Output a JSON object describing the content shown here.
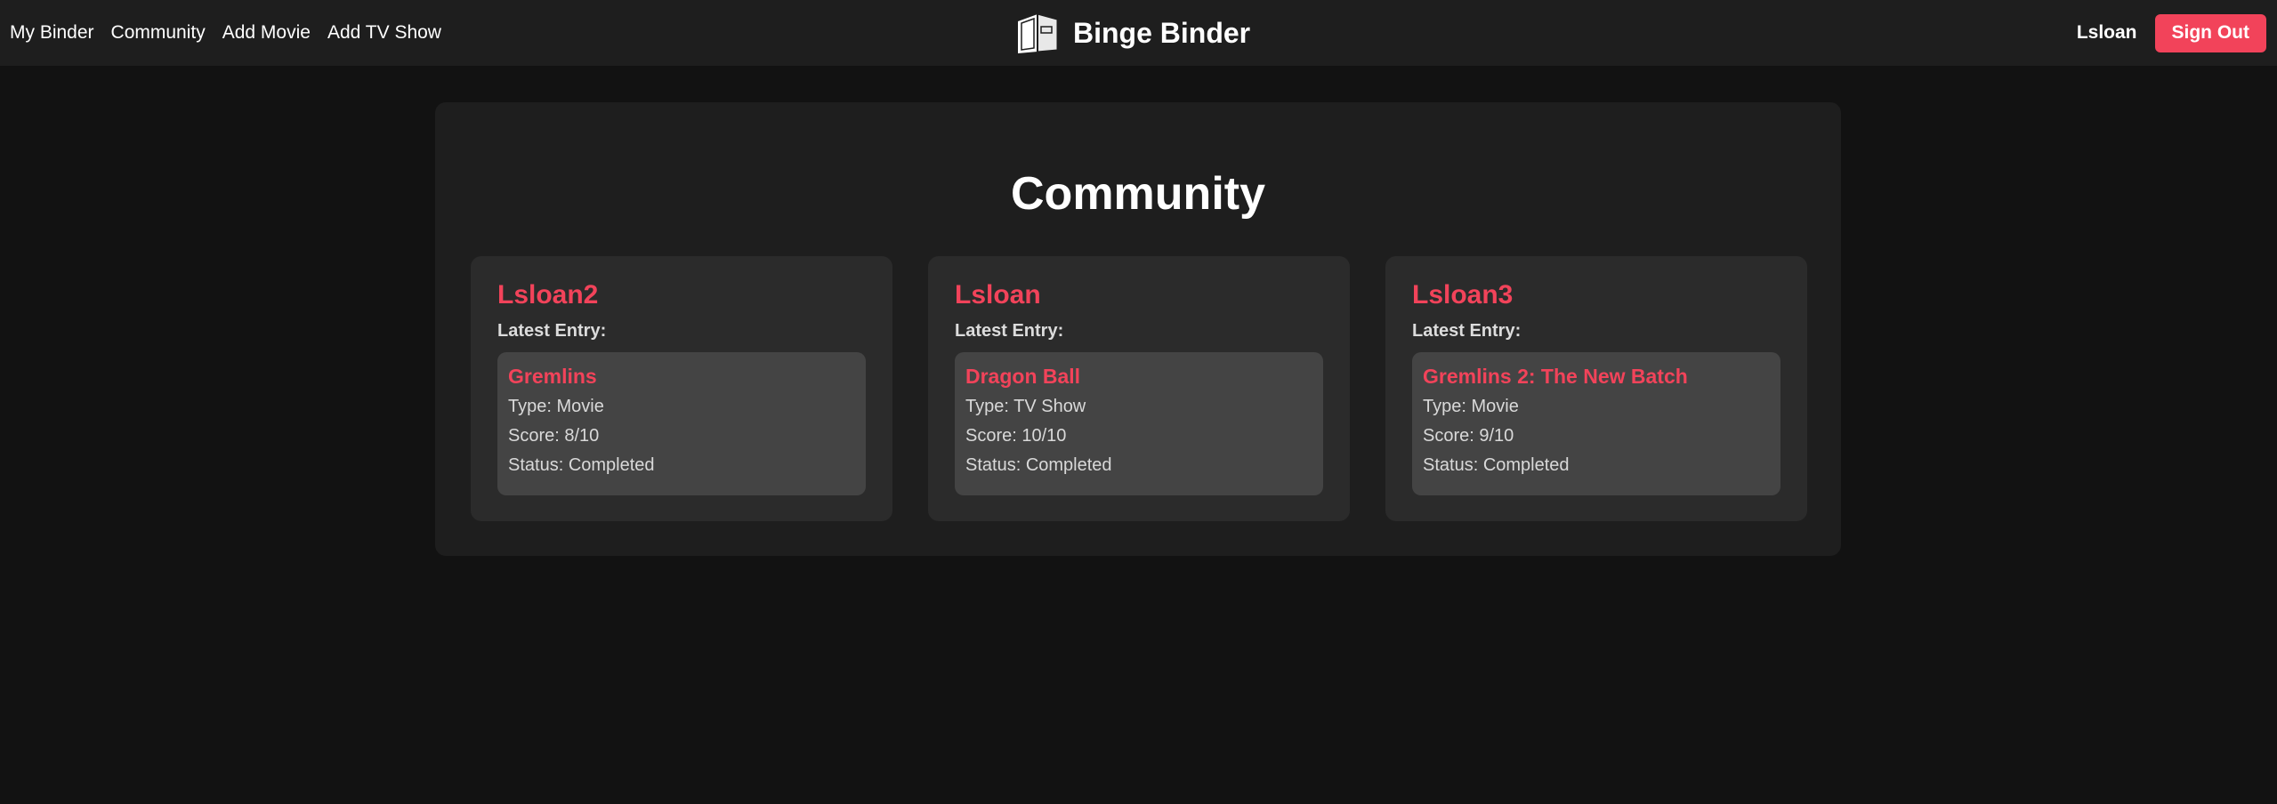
{
  "nav": {
    "links": [
      "My Binder",
      "Community",
      "Add Movie",
      "Add TV Show"
    ],
    "brand": "Binge Binder",
    "username": "Lsloan",
    "signout_label": "Sign Out"
  },
  "page": {
    "title": "Community"
  },
  "cards": [
    {
      "user": "Lsloan2",
      "latest_label": "Latest Entry:",
      "entry": {
        "title": "Gremlins",
        "type": "Type: Movie",
        "score": "Score: 8/10",
        "status": "Status: Completed"
      }
    },
    {
      "user": "Lsloan",
      "latest_label": "Latest Entry:",
      "entry": {
        "title": "Dragon Ball",
        "type": "Type: TV Show",
        "score": "Score: 10/10",
        "status": "Status: Completed"
      }
    },
    {
      "user": "Lsloan3",
      "latest_label": "Latest Entry:",
      "entry": {
        "title": "Gremlins 2: The New Batch",
        "type": "Type: Movie",
        "score": "Score: 9/10",
        "status": "Status: Completed"
      }
    }
  ],
  "colors": {
    "accent": "#f2435a",
    "background": "#121212",
    "navbar": "#1e1e1e",
    "card": "#2b2b2b",
    "entry": "#444444"
  },
  "icons": {
    "brand": "binder-icon"
  }
}
